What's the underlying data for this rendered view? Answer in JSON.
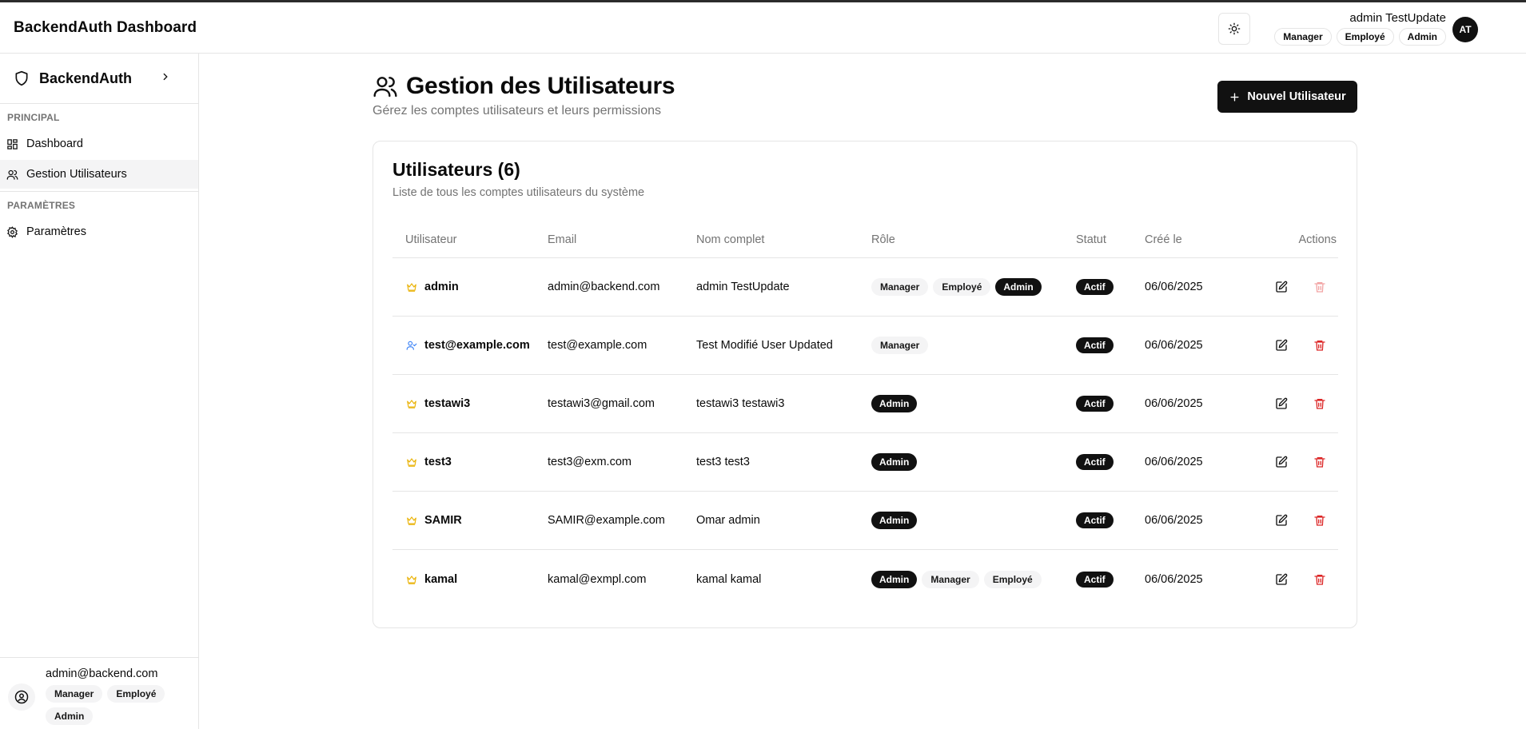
{
  "header": {
    "title": "BackendAuth Dashboard",
    "user_name": "admin TestUpdate",
    "user_roles": [
      "Manager",
      "Employé",
      "Admin"
    ],
    "avatar_initials": "AT"
  },
  "sidebar": {
    "brand": "BackendAuth",
    "group_principal": "PRINCIPAL",
    "group_params": "PARAMÈTRES",
    "items": [
      {
        "label": "Dashboard"
      },
      {
        "label": "Gestion Utilisateurs"
      },
      {
        "label": "Paramètres"
      }
    ],
    "footer": {
      "email": "admin@backend.com",
      "roles": [
        "Manager",
        "Employé",
        "Admin"
      ]
    }
  },
  "main": {
    "title": "Gestion des Utilisateurs",
    "subtitle": "Gérez les comptes utilisateurs et leurs permissions",
    "new_user_label": "Nouvel Utilisateur",
    "card_title": "Utilisateurs (6)",
    "card_subtitle": "Liste de tous les comptes utilisateurs du système",
    "columns": [
      "Utilisateur",
      "Email",
      "Nom complet",
      "Rôle",
      "Statut",
      "Créé le",
      "Actions"
    ],
    "rows": [
      {
        "user": "admin",
        "email": "admin@backend.com",
        "name": "admin TestUpdate",
        "roles": [
          "Manager",
          "Employé",
          "Admin"
        ],
        "status": "Actif",
        "created": "06/06/2025",
        "icon": "crown-icon",
        "delete_disabled": true
      },
      {
        "user": "test@example.com",
        "email": "test@example.com",
        "name": "Test Modifié User Updated",
        "roles": [
          "Manager"
        ],
        "status": "Actif",
        "created": "06/06/2025",
        "icon": "user-check-icon",
        "delete_disabled": false
      },
      {
        "user": "testawi3",
        "email": "testawi3@gmail.com",
        "name": "testawi3 testawi3",
        "roles": [
          "Admin"
        ],
        "status": "Actif",
        "created": "06/06/2025",
        "icon": "crown-icon",
        "delete_disabled": false
      },
      {
        "user": "test3",
        "email": "test3@exm.com",
        "name": "test3 test3",
        "roles": [
          "Admin"
        ],
        "status": "Actif",
        "created": "06/06/2025",
        "icon": "crown-icon",
        "delete_disabled": false
      },
      {
        "user": "SAMIR",
        "email": "SAMIR@example.com",
        "name": "Omar admin",
        "roles": [
          "Admin"
        ],
        "status": "Actif",
        "created": "06/06/2025",
        "icon": "crown-icon",
        "delete_disabled": false
      },
      {
        "user": "kamal",
        "email": "kamal@exmpl.com",
        "name": "kamal kamal",
        "roles": [
          "Admin",
          "Manager",
          "Employé"
        ],
        "status": "Actif",
        "created": "06/06/2025",
        "icon": "crown-icon",
        "delete_disabled": false
      }
    ]
  },
  "colors": {
    "crown": "#eab308",
    "user_check": "#3b82f6",
    "delete": "#dc2626",
    "delete_disabled": "#f2a4a4",
    "dark_badge": "#111111"
  }
}
